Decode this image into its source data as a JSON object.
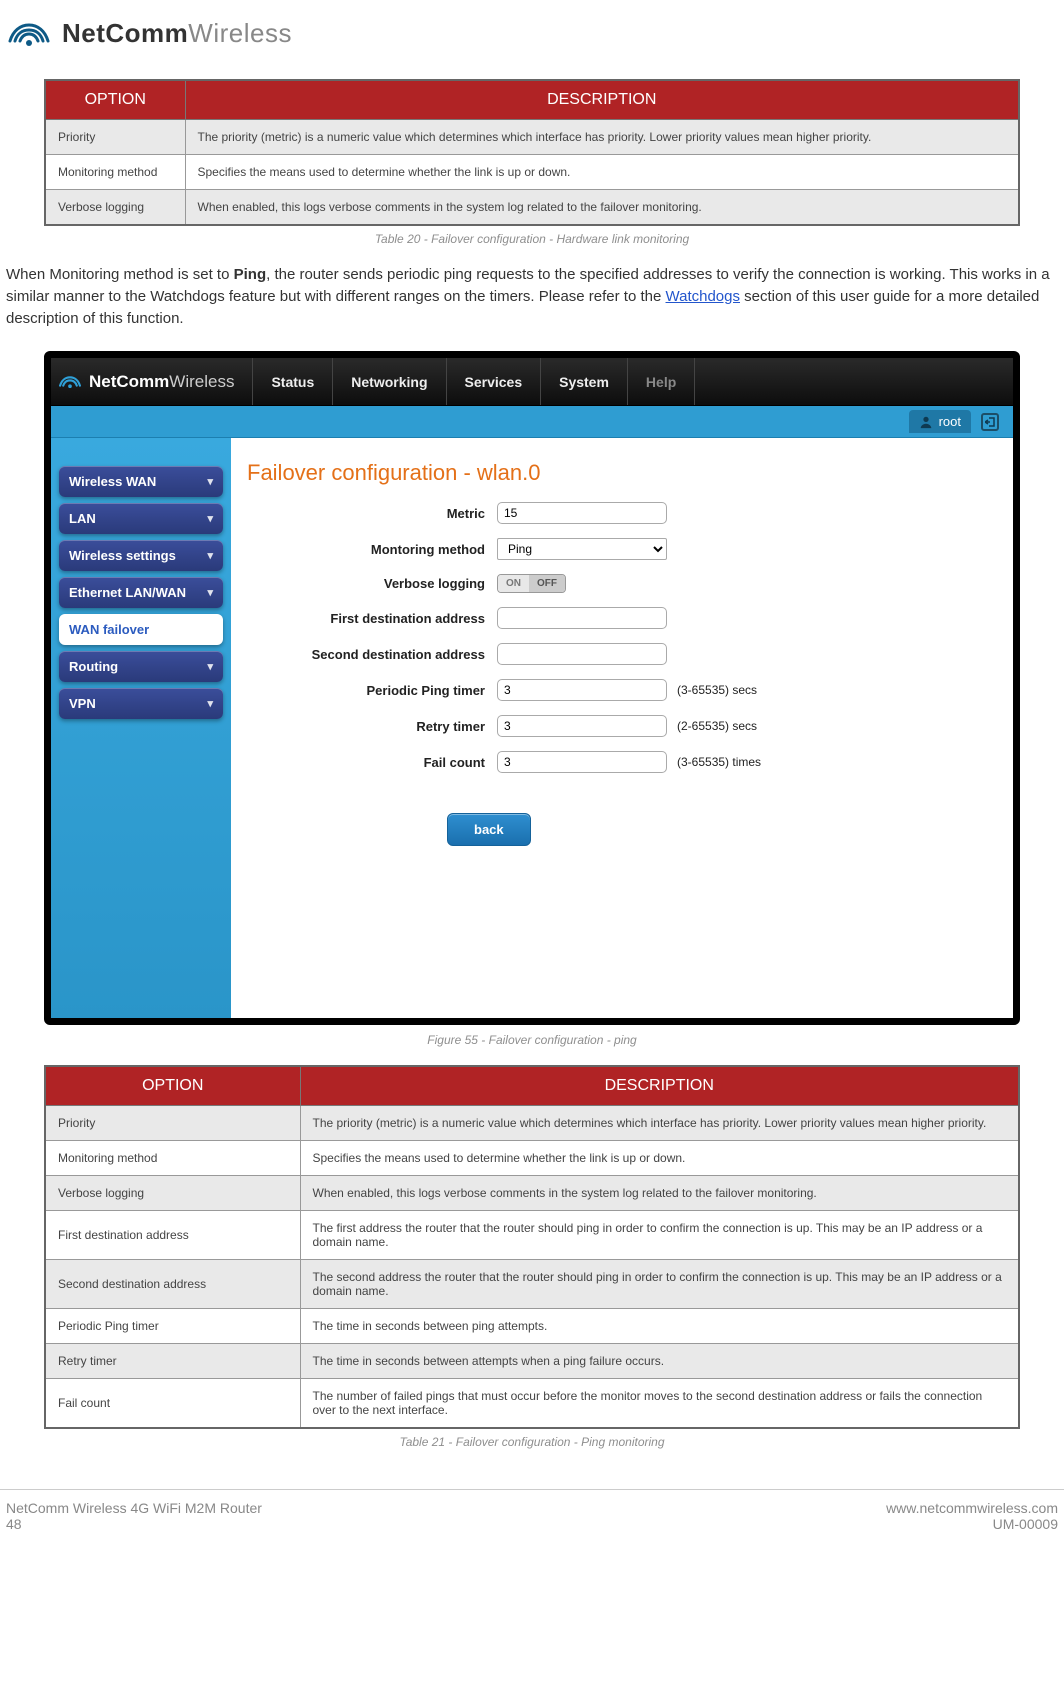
{
  "brand": {
    "bold": "NetComm",
    "light": "Wireless"
  },
  "table1": {
    "headers": [
      "OPTION",
      "DESCRIPTION"
    ],
    "rows": [
      [
        "Priority",
        "The priority (metric) is a numeric value which determines which interface has priority. Lower priority values mean higher priority."
      ],
      [
        "Monitoring method",
        "Specifies the means used to determine whether the link is up or down."
      ],
      [
        "Verbose logging",
        "When enabled, this logs verbose comments in the system log related to the failover monitoring."
      ]
    ],
    "caption": "Table 20 - Failover configuration - Hardware link monitoring"
  },
  "paragraph": {
    "pre": "When Monitoring method is set to ",
    "bold": "Ping",
    "mid1": ", the router sends periodic ping requests to the specified addresses to verify the connection is working. This works in a similar manner to the Watchdogs feature but with different ranges on the timers. Please refer to the ",
    "link": "Watchdogs",
    "mid2": " section of this user guide for a more detailed description of this function."
  },
  "screenshot": {
    "brand_bold": "NetComm",
    "brand_light": "Wireless",
    "nav": [
      "Status",
      "Networking",
      "Services",
      "System",
      "Help"
    ],
    "user": "root",
    "sidebar": [
      {
        "label": "Wireless WAN",
        "selected": false
      },
      {
        "label": "LAN",
        "selected": false
      },
      {
        "label": "Wireless settings",
        "selected": false
      },
      {
        "label": "Ethernet LAN/WAN",
        "selected": false
      },
      {
        "label": "WAN failover",
        "selected": true
      },
      {
        "label": "Routing",
        "selected": false
      },
      {
        "label": "VPN",
        "selected": false
      }
    ],
    "panel_title": "Failover configuration - wlan.0",
    "fields": {
      "metric_label": "Metric",
      "metric_value": "15",
      "monitoring_label": "Montoring method",
      "monitoring_value": "Ping",
      "verbose_label": "Verbose logging",
      "toggle_on": "ON",
      "toggle_off": "OFF",
      "first_dest_label": "First destination address",
      "first_dest_value": "",
      "second_dest_label": "Second destination address",
      "second_dest_value": "",
      "ping_timer_label": "Periodic Ping timer",
      "ping_timer_value": "3",
      "ping_timer_hint": "(3-65535) secs",
      "retry_timer_label": "Retry timer",
      "retry_timer_value": "3",
      "retry_timer_hint": "(2-65535) secs",
      "fail_count_label": "Fail count",
      "fail_count_value": "3",
      "fail_count_hint": "(3-65535) times"
    },
    "back": "back"
  },
  "fig_caption": "Figure 55 - Failover configuration - ping",
  "table2": {
    "headers": [
      "OPTION",
      "DESCRIPTION"
    ],
    "rows": [
      [
        "Priority",
        "The priority (metric) is a numeric value which determines which interface has priority. Lower priority values mean higher priority."
      ],
      [
        "Monitoring method",
        "Specifies the means used to determine whether the link is up or down."
      ],
      [
        "Verbose logging",
        "When enabled, this logs verbose comments in the system log related to the failover monitoring."
      ],
      [
        "First destination address",
        "The first address the router that the router should ping in order to confirm the connection is up. This may be an IP address or a domain name."
      ],
      [
        "Second destination address",
        "The second address the router that the router should ping in order to confirm the connection is up. This may be an IP address or a domain name."
      ],
      [
        "Periodic Ping timer",
        "The time in seconds between ping attempts."
      ],
      [
        "Retry timer",
        "The time in seconds between attempts when a ping failure occurs."
      ],
      [
        "Fail count",
        "The number of failed pings that must occur before the monitor moves to the second destination address or fails the connection over to the next interface."
      ]
    ],
    "caption": "Table 21 - Failover configuration - Ping monitoring"
  },
  "footer": {
    "left1": "NetComm Wireless 4G WiFi M2M Router",
    "left2": "48",
    "right1": "www.netcommwireless.com",
    "right2": "UM-00009"
  }
}
